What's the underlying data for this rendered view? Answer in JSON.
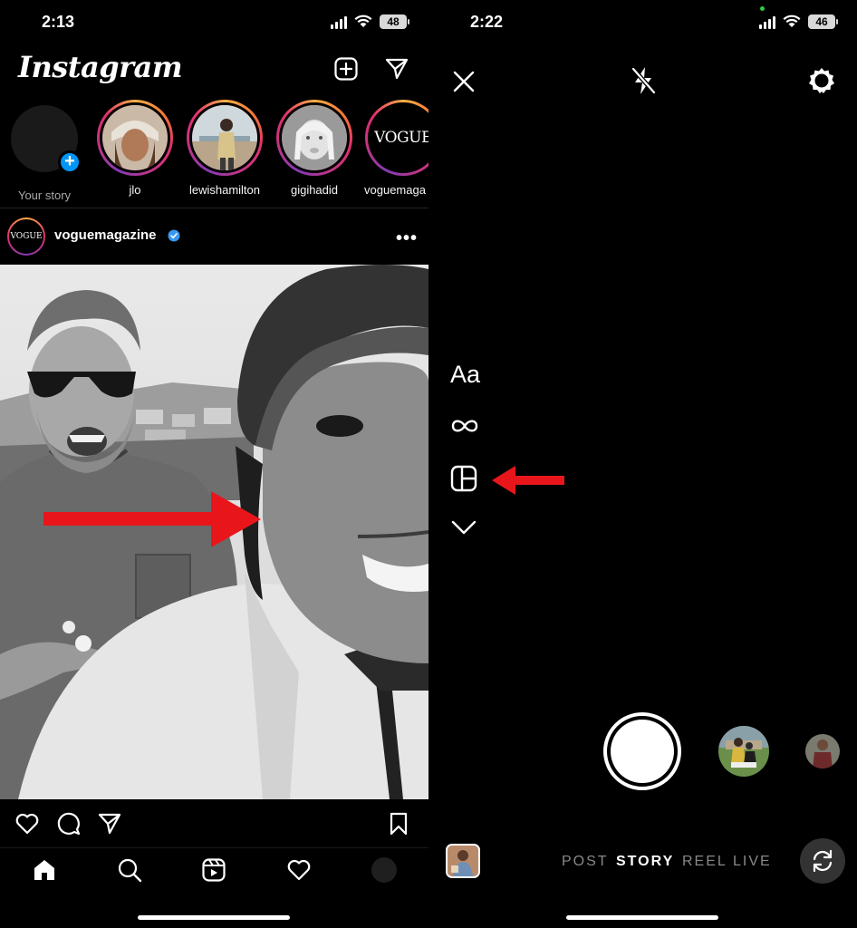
{
  "left": {
    "status": {
      "time": "2:13",
      "battery": "48"
    },
    "app_title": "Instagram",
    "stories": [
      {
        "label": "Your story"
      },
      {
        "label": "jlo"
      },
      {
        "label": "lewishamilton"
      },
      {
        "label": "gigihadid"
      },
      {
        "label": "voguemaga"
      }
    ],
    "vogue_logo_text": "VOGUE",
    "post": {
      "username": "voguemagazine",
      "avatar_text": "VOGUE",
      "more": "•••"
    }
  },
  "right": {
    "status": {
      "time": "2:22",
      "battery": "46"
    },
    "tools": {
      "text_tool": "Aa"
    },
    "modes": [
      {
        "label": "POST",
        "active": false
      },
      {
        "label": "STORY",
        "active": true
      },
      {
        "label": "REEL",
        "active": false
      },
      {
        "label": "LIVE",
        "active": false
      }
    ]
  },
  "colors": {
    "accent_blue": "#0095f6",
    "arrow_red": "#e8161b",
    "verified": "#3897f0"
  }
}
